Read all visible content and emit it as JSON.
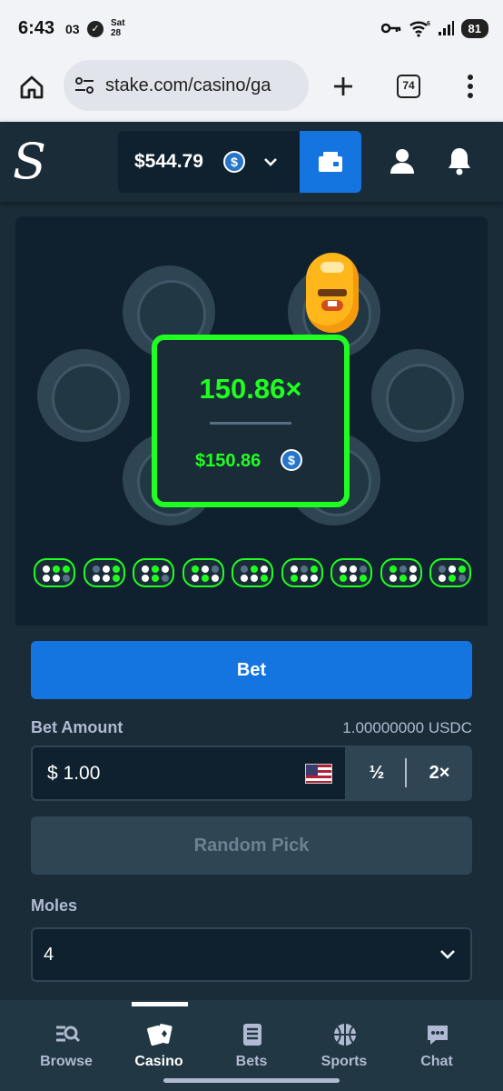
{
  "status_bar": {
    "time": "6:43",
    "notif_count": "03",
    "day": "Sat",
    "date": "28",
    "signal_label": "6",
    "battery": "81"
  },
  "browser": {
    "url": "stake.com/casino/ga",
    "tab_count": "74"
  },
  "header": {
    "logo": "S",
    "balance": "$544.79",
    "currency_icon": "usdc-icon"
  },
  "game": {
    "multiplier": "150.86×",
    "payout": "$150.86",
    "win_color": "#1fff20",
    "history_count": 9
  },
  "controls": {
    "bet_label": "Bet",
    "bet_amount_label": "Bet Amount",
    "bet_amount_crypto": "1.00000000 USDC",
    "amount_value": "$ 1.00",
    "half_label": "½",
    "double_label": "2×",
    "random_pick_label": "Random Pick",
    "moles_label": "Moles",
    "moles_value": "4"
  },
  "nav": {
    "items": [
      {
        "label": "Browse",
        "icon": "browse-icon"
      },
      {
        "label": "Casino",
        "icon": "casino-icon"
      },
      {
        "label": "Bets",
        "icon": "bets-icon"
      },
      {
        "label": "Sports",
        "icon": "sports-icon"
      },
      {
        "label": "Chat",
        "icon": "chat-icon"
      }
    ],
    "active": "Casino"
  },
  "colors": {
    "accent_blue": "#1475e1",
    "bg": "#1a2c38",
    "panel": "#0f212e"
  }
}
